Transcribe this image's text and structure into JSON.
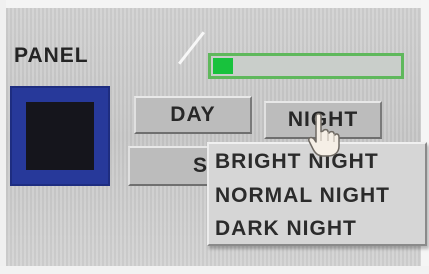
{
  "panel": {
    "label": "PANEL",
    "box_color": "#27399a",
    "inner_color": "#15151c"
  },
  "progress": {
    "value_fraction": 0.11,
    "fill_color": "#18c23d",
    "border_color": "#5fb85c"
  },
  "buttons": {
    "day_label": "DAY",
    "night_label": "NIGHT",
    "s_label": "S"
  },
  "night_menu": {
    "items": [
      {
        "label": "BRIGHT NIGHT"
      },
      {
        "label": "NORMAL NIGHT"
      },
      {
        "label": "DARK NIGHT"
      }
    ]
  },
  "cursor": {
    "icon": "pointing-hand-icon"
  }
}
